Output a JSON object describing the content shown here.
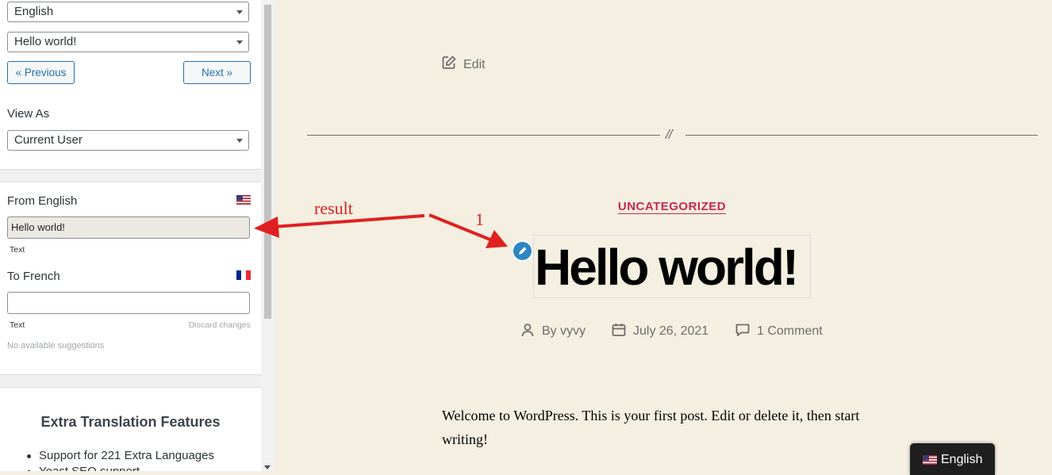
{
  "sidebar": {
    "language_select": "English",
    "string_select": "Hello world!",
    "prev_label": "« Previous",
    "next_label": "Next »",
    "view_as_label": "View As",
    "view_as_select": "Current User",
    "from_label": "From English",
    "from_value": "Hello world!",
    "from_type": "Text",
    "to_label": "To French",
    "to_value": "",
    "to_type": "Text",
    "discard_label": "Discard changes",
    "no_suggestions": "No available suggestions",
    "features_title": "Extra Translation Features",
    "features": [
      "Support for 221 Extra Languages",
      "Yoast SEO support"
    ]
  },
  "preview": {
    "edit_label": "Edit",
    "separator": "//",
    "category": "UNCATEGORIZED",
    "post_title": "Hello world!",
    "author": "By vyvy",
    "date": "July 26, 2021",
    "comments": "1 Comment",
    "body": "Welcome to WordPress. This is your first post. Edit or delete it, then start writing!",
    "language_switcher": "English"
  },
  "annotations": {
    "result_label": "result",
    "step_label": "1",
    "arrow_color": "#e02020"
  },
  "colors": {
    "accent": "#cd2653",
    "wp_blue": "#2271b1",
    "page_bg": "#f4efe1"
  }
}
